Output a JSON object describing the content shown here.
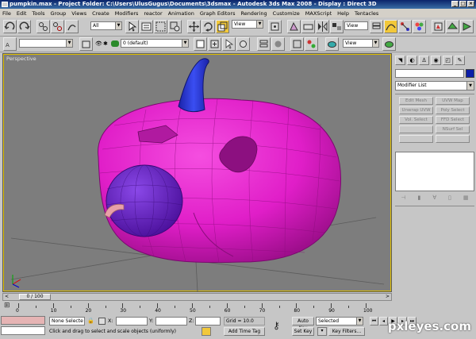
{
  "window": {
    "title": "pumpkin.max   - Project Folder: C:\\Users\\UlusGugus\\Documents\\3dsmax    - Autodesk 3ds Max 2008    - Display : Direct 3D",
    "buttons": [
      "_",
      "□",
      "×"
    ]
  },
  "menu": [
    "File",
    "Edit",
    "Tools",
    "Group",
    "Views",
    "Create",
    "Modifiers",
    "reactor",
    "Animation",
    "Graph Editors",
    "Rendering",
    "Customize",
    "MAXScript",
    "Help",
    "Tentacles"
  ],
  "toolbar": {
    "selection_filter": "All",
    "ref_coord": "View",
    "render_view": "View",
    "layer": "0 (default)",
    "named_selection": ""
  },
  "viewport": {
    "label": "Perspective"
  },
  "command_panel": {
    "tabs": [
      "◥",
      "◐",
      "♙",
      "◉",
      "◰",
      "✎"
    ],
    "object_color": "#0c1ea8",
    "modifier_list": "Modifier List",
    "modifier_buttons": [
      "Edit Mesh",
      "UVW Map",
      "Unwrap UVW",
      "Poly Select",
      "Vol. Select",
      "FFD Select",
      "",
      "NSurf Sel",
      "",
      ""
    ]
  },
  "time_slider": {
    "frame_display": "0 / 100",
    "current_frame": 0,
    "total_frames": 100
  },
  "timeline": {
    "labels": [
      "0",
      "10",
      "20",
      "30",
      "40",
      "50",
      "60",
      "70",
      "80",
      "90",
      "100"
    ]
  },
  "status": {
    "selection": "None Selecte",
    "x_label": "X:",
    "y_label": "Y:",
    "z_label": "Z:",
    "x_value": "",
    "y_value": "",
    "z_value": "",
    "grid": "Grid = 10.0",
    "prompt": "Click and drag to select and scale objects (uniformly)",
    "add_time_tag": "Add Time Tag",
    "auto_key": "Auto Key",
    "set_key": "Set Key",
    "key_mode": "Selected",
    "key_filters": "Key Filters..."
  },
  "watermark": "pxleyes.com",
  "colors": {
    "pumpkin": "#e01ec8",
    "stem": "#2232d6",
    "eye": "#6a1fc0",
    "nose": "#e0909a",
    "viewport_bg": "#7d7d7d"
  }
}
